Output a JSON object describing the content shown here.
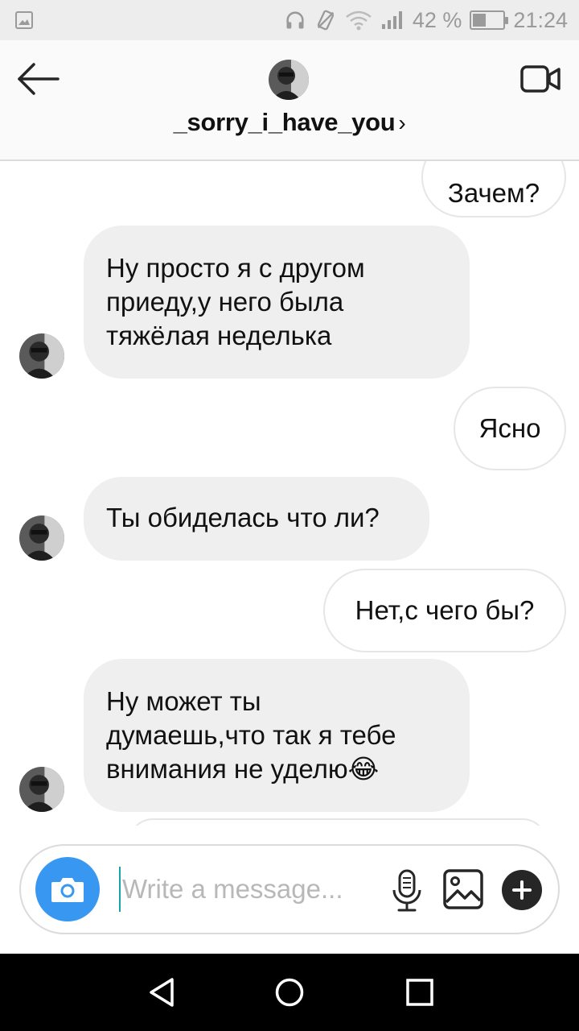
{
  "status_bar": {
    "battery_percent": "42 %",
    "time": "21:24",
    "battery_level": 0.42
  },
  "header": {
    "username": "_sorry_i_have_you",
    "chevron": "›",
    "icons": {
      "back": "arrow-left-icon",
      "video": "video-camera-icon"
    }
  },
  "messages": [
    {
      "direction": "out",
      "text": "Зачем?"
    },
    {
      "direction": "in",
      "lines": [
        "Ну просто я с другом",
        "приеду,у него была",
        "тяжёлая неделька"
      ]
    },
    {
      "direction": "out",
      "text": "Ясно"
    },
    {
      "direction": "in",
      "lines": [
        "Ты обиделась что ли?"
      ]
    },
    {
      "direction": "out",
      "text": "Нет,с чего бы?"
    },
    {
      "direction": "in",
      "lines": [
        "Ну может ты",
        "думаешь,что так я тебе",
        "внимания не уделю😂"
      ]
    }
  ],
  "composer": {
    "placeholder": "Write a message...",
    "icons": {
      "camera": "camera-icon",
      "mic": "microphone-icon",
      "gallery": "image-icon",
      "plus": "plus-icon"
    }
  },
  "colors": {
    "accent_blue": "#3897f0",
    "incoming_bubble": "#efefef",
    "header_bg": "#fafafa"
  }
}
